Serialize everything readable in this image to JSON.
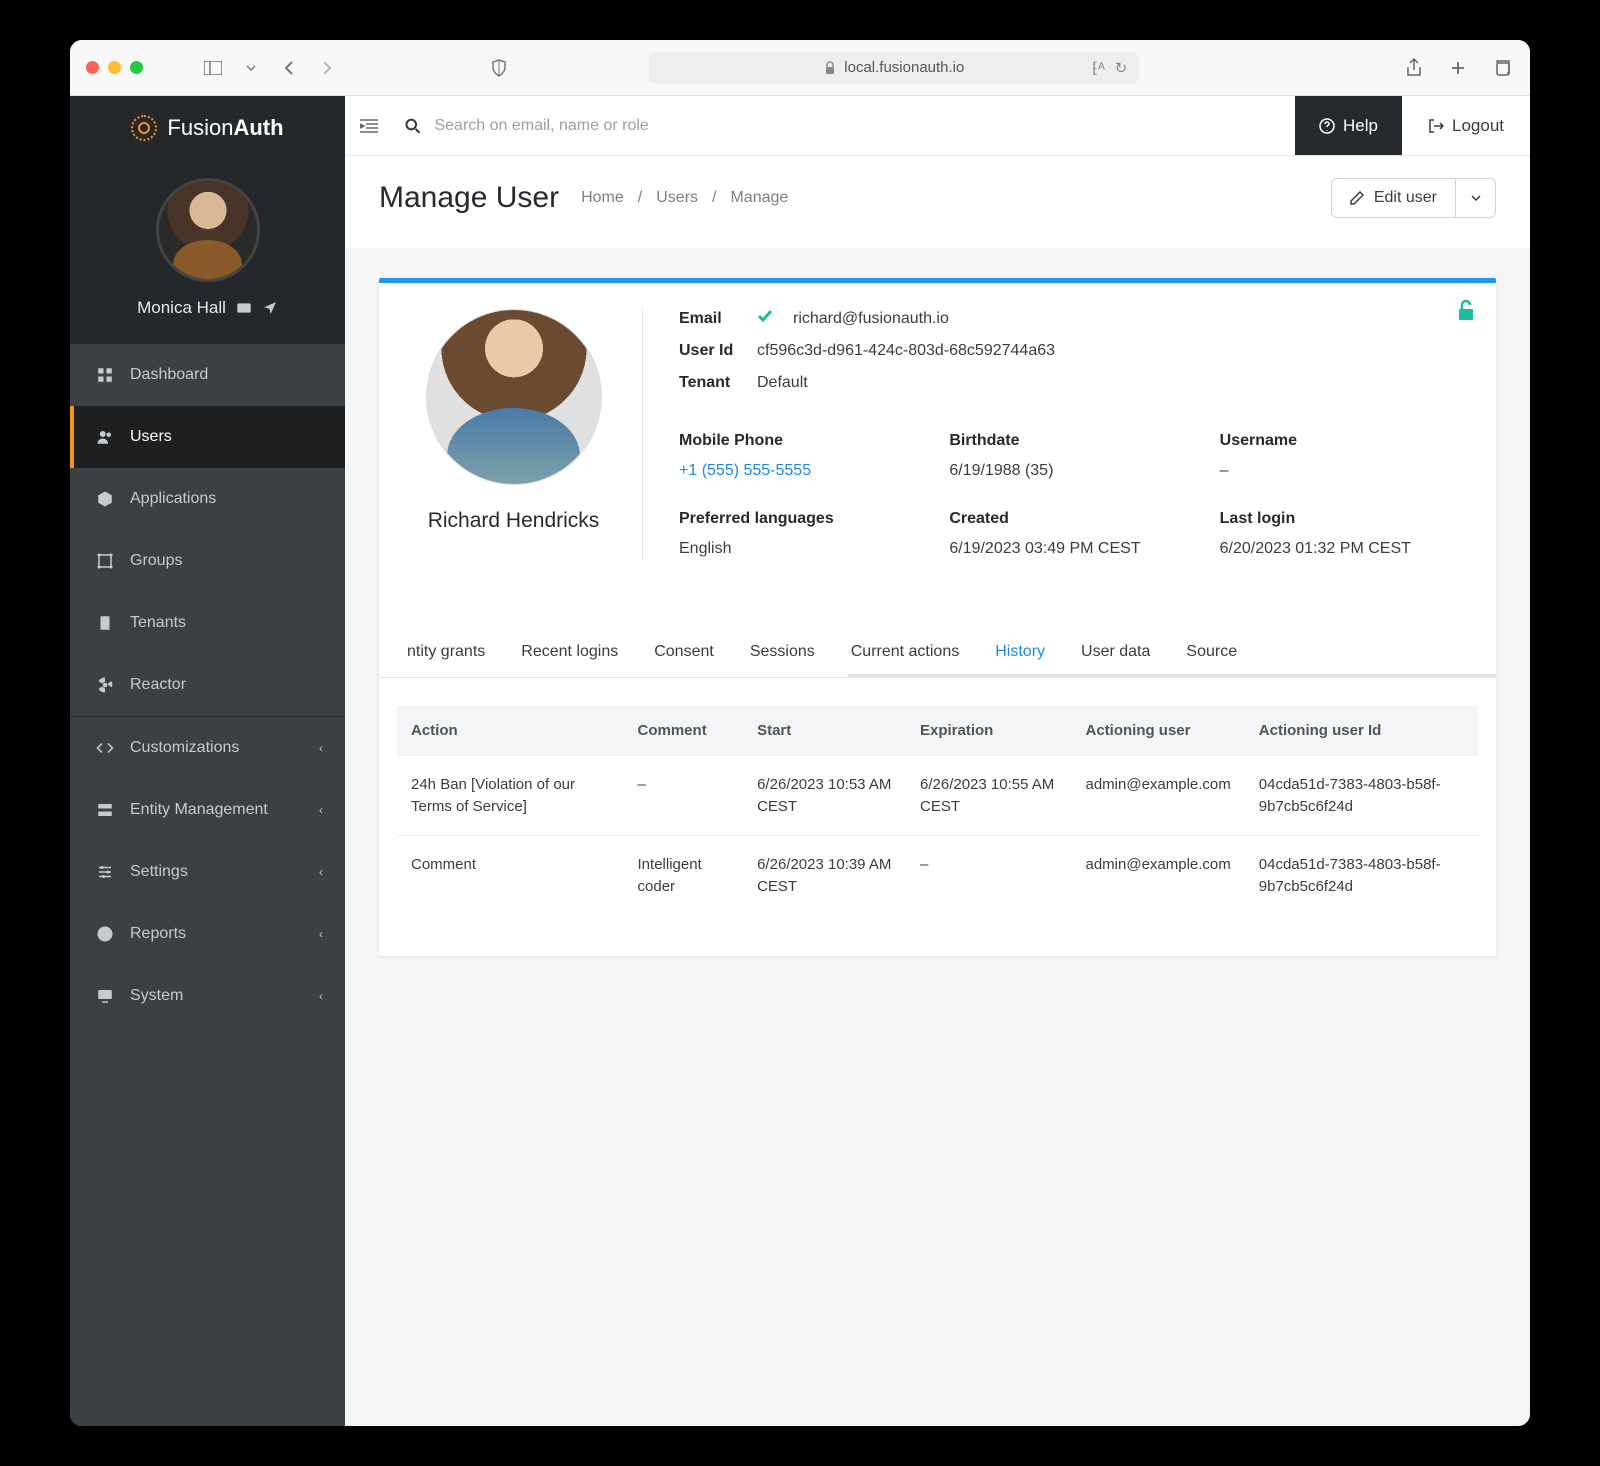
{
  "browser": {
    "url": "local.fusionauth.io"
  },
  "brand": {
    "name_a": "Fusion",
    "name_b": "Auth"
  },
  "current_user": {
    "name": "Monica Hall"
  },
  "sidebar": {
    "items": [
      {
        "label": "Dashboard"
      },
      {
        "label": "Users"
      },
      {
        "label": "Applications"
      },
      {
        "label": "Groups"
      },
      {
        "label": "Tenants"
      },
      {
        "label": "Reactor"
      },
      {
        "label": "Customizations"
      },
      {
        "label": "Entity Management"
      },
      {
        "label": "Settings"
      },
      {
        "label": "Reports"
      },
      {
        "label": "System"
      }
    ]
  },
  "topbar": {
    "search_placeholder": "Search on email, name or role",
    "help": "Help",
    "logout": "Logout"
  },
  "page": {
    "title": "Manage User",
    "breadcrumb": [
      "Home",
      "Users",
      "Manage"
    ],
    "edit": "Edit user"
  },
  "user": {
    "name": "Richard Hendricks",
    "email_label": "Email",
    "email": "richard@fusionauth.io",
    "userid_label": "User Id",
    "userid": "cf596c3d-d961-424c-803d-68c592744a63",
    "tenant_label": "Tenant",
    "tenant": "Default",
    "details": {
      "mobile_phone": {
        "label": "Mobile Phone",
        "value": "+1 (555) 555-5555"
      },
      "birthdate": {
        "label": "Birthdate",
        "value": "6/19/1988 (35)"
      },
      "username": {
        "label": "Username",
        "value": "–"
      },
      "pref_lang": {
        "label": "Preferred languages",
        "value": "English"
      },
      "created": {
        "label": "Created",
        "value": "6/19/2023 03:49 PM CEST"
      },
      "last_login": {
        "label": "Last login",
        "value": "6/20/2023 01:32 PM CEST"
      }
    }
  },
  "tabs": [
    "ntity grants",
    "Recent logins",
    "Consent",
    "Sessions",
    "Current actions",
    "History",
    "User data",
    "Source"
  ],
  "history_table": {
    "columns": [
      "Action",
      "Comment",
      "Start",
      "Expiration",
      "Actioning user",
      "Actioning user Id"
    ],
    "rows": [
      {
        "action": "24h Ban [Violation of our Terms of Service]",
        "comment": "–",
        "start": "6/26/2023 10:53 AM CEST",
        "expiration": "6/26/2023 10:55 AM CEST",
        "actioning_user": "admin@example.com",
        "actioning_user_id": "04cda51d-7383-4803-b58f-9b7cb5c6f24d"
      },
      {
        "action": "Comment",
        "comment": "Intelligent coder",
        "start": "6/26/2023 10:39 AM CEST",
        "expiration": "–",
        "actioning_user": "admin@example.com",
        "actioning_user_id": "04cda51d-7383-4803-b58f-9b7cb5c6f24d"
      }
    ]
  }
}
